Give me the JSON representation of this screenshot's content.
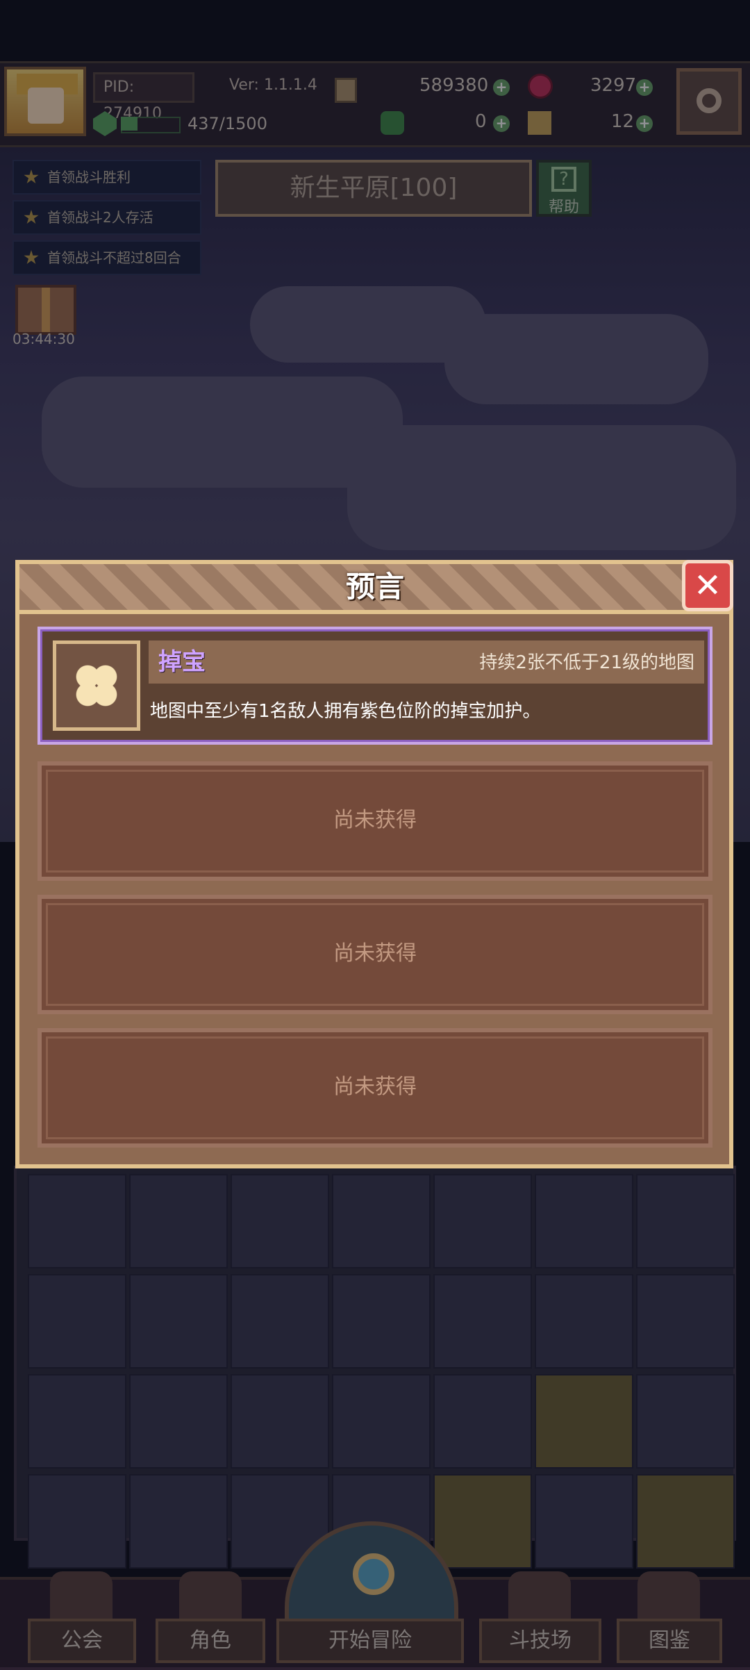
{
  "topbar": {
    "pid": "PID: 274910",
    "version": "Ver: 1.1.1.4",
    "gold": "589380",
    "gems": "3297",
    "energy": "437/1500",
    "energy_fraction": 0.29,
    "clover": "0",
    "boots": "12",
    "plus": "+"
  },
  "quests": [
    "首领战斗胜利",
    "首领战斗2人存活",
    "首领战斗不超过8回合"
  ],
  "gift_timer": "03:44:30",
  "stage": "新生平原[100]",
  "help_label": "帮助",
  "modal": {
    "title": "预言",
    "card": {
      "name": "掉宝",
      "condition": "持续2张不低于21级的地图",
      "description": "地图中至少有1名敌人拥有紫色位阶的掉宝加护。"
    },
    "empty_slots": [
      "尚未获得",
      "尚未获得",
      "尚未获得"
    ]
  },
  "nav": {
    "guild": "公会",
    "role": "角色",
    "adventure": "开始冒险",
    "arena": "斗技场",
    "codex": "图鉴"
  },
  "colors": {
    "accent_purple": "#cfa3ff",
    "close_red": "#d94848",
    "energy_green": "#5aa863"
  }
}
